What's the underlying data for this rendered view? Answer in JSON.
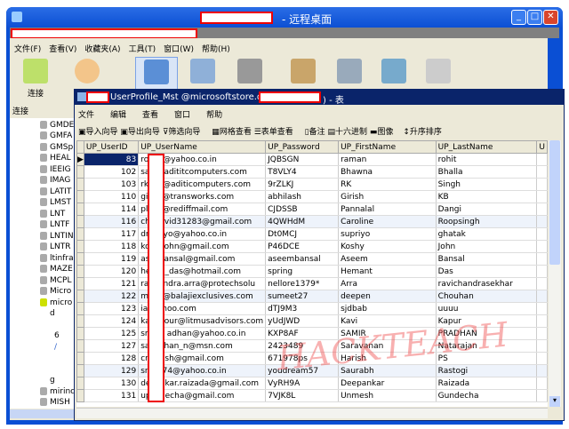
{
  "window": {
    "title": "- 远程桌面",
    "colors": {
      "title": "#0b4ed2",
      "inner_title": "#0a246a",
      "watermark": "#f05050",
      "redaction": "#ee0000"
    }
  },
  "menu": [
    "文件(F)",
    "查看(V)",
    "收藏夹(A)",
    "工具(T)",
    "窗口(W)",
    "帮助(H)"
  ],
  "toolbar": {
    "connect_label": "连接",
    "icons": [
      "connect-icon",
      "user-icon",
      "table-icon",
      "view-icon",
      "function-icon",
      "other-icon",
      "query-icon",
      "report-icon",
      "schedule-icon"
    ]
  },
  "left_panel": {
    "header": "连接",
    "tree": [
      "GMDE",
      "GMFA",
      "GMSp",
      "HEAL",
      "IEEIG",
      "IMAG",
      "LATIT",
      "LMST",
      "LNT",
      "LNTF",
      "LNTIN",
      "LNTR",
      "ltinfra",
      "MAZE",
      "MCPL",
      "Micro",
      "micro",
      "d",
      "",
      "6",
      "/",
      "",
      "",
      "g",
      "mirinc",
      "MISH"
    ]
  },
  "inner": {
    "title": "UserProfile_Mst @microsoftstore.dbo (",
    "title_suffix": ") - 表",
    "menu": [
      "文件",
      "编辑",
      "查看",
      "窗口",
      "帮助"
    ],
    "toolbar": [
      "导入向导",
      "导出向导",
      "筛选向导",
      "网格查看",
      "表单查看",
      "备注",
      "十六进制",
      "图像",
      "升序排序"
    ],
    "columns": [
      "UP_UserID",
      "UP_UserName",
      "UP_Password",
      "UP_FirstName",
      "UP_LastName",
      "U"
    ],
    "rows": [
      [
        "83",
        "ro",
        "@yahoo.co.in",
        "JQBSGN",
        "raman",
        "rohit"
      ],
      [
        "102",
        "sa",
        "adititcomputers.com",
        "T8VLY4",
        "Bhawna",
        "Bhalla"
      ],
      [
        "103",
        "rk",
        "@aditicomputers.com",
        "9rZLKJ",
        "RK",
        "Singh"
      ],
      [
        "110",
        "gi",
        "@transworks.com",
        "abhilash",
        "Girish",
        "KB"
      ],
      [
        "114",
        "pl",
        "@rediffmail.com",
        "CJDSSB",
        "Pannalal",
        "Dangi"
      ],
      [
        "116",
        "ch",
        "vid31283@gmail.com",
        "4QWHdM",
        "Caroline",
        "Roopsingh"
      ],
      [
        "117",
        "dr",
        "yo@yahoo.co.in",
        "Dt0MCJ",
        "supriyo",
        "ghatak"
      ],
      [
        "118",
        "ko",
        "ohn@gmail.com",
        "P46DCE",
        "Koshy",
        "John"
      ],
      [
        "119",
        "as",
        "ansal@gmail.com",
        "aseembansal",
        "Aseem",
        "Bansal"
      ],
      [
        "120",
        "he",
        "_das@hotmail.com",
        "spring",
        "Hemant",
        "Das"
      ],
      [
        "121",
        "ra",
        "ndra.arra@protechsolu",
        "nellore1379*",
        "Arra",
        "ravichandrasekhar"
      ],
      [
        "122",
        "m",
        "@balajiexclusives.com",
        "sumeet27",
        "deepen",
        "Chouhan"
      ],
      [
        "123",
        "ia",
        "hoo.com",
        "dTJ9M3",
        "sjdbab",
        "uuuu"
      ],
      [
        "124",
        "ka",
        "our@litmusadvisors.com",
        "yUdJWD",
        "Kavi",
        "Kapur"
      ],
      [
        "125",
        "sm",
        "adhan@yahoo.co.in",
        "KXP8AF",
        "SAMIR",
        "PRADHAN"
      ],
      [
        "127",
        "sa",
        "han_n@msn.com",
        "2423489",
        "Saravanan",
        "Natarajan"
      ],
      [
        "128",
        "cr",
        "ish@gmail.com",
        "671978ps",
        "Harish",
        "PS"
      ],
      [
        "129",
        "sr",
        "74@yahoo.co.in",
        "youdream57",
        "Saurabh",
        "Rastogi"
      ],
      [
        "130",
        "de",
        "kar.raizada@gmail.com",
        "VyRH9A",
        "Deepankar",
        "Raizada"
      ],
      [
        "131",
        "up",
        "echa@gmail.com",
        "7VJK8L",
        "Unmesh",
        "Gundecha"
      ]
    ]
  },
  "watermark": "HACKTEACH"
}
